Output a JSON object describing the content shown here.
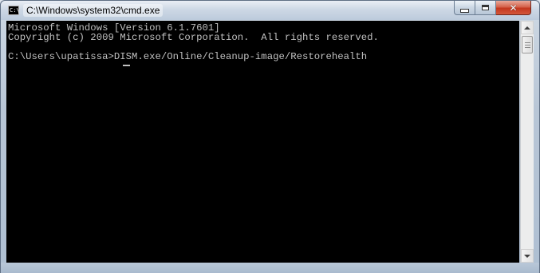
{
  "window": {
    "title": "C:\\Windows\\system32\\cmd.exe",
    "icon": "cmd-icon",
    "icon_text": "C:\\",
    "controls": {
      "minimize": "minimize-icon",
      "maximize": "maximize-icon",
      "close_glyph": "✕"
    }
  },
  "console": {
    "lines": [
      "Microsoft Windows [Version 6.1.7601]",
      "Copyright (c) 2009 Microsoft Corporation.  All rights reserved.",
      "",
      "C:\\Users\\upatissa>DISM.exe/Online/Cleanup-image/Restorehealth"
    ],
    "background": "#000000",
    "foreground": "#c0c0c0"
  },
  "scrollbar": {
    "up_arrow": "scroll-up-icon",
    "down_arrow": "scroll-down-icon"
  }
}
